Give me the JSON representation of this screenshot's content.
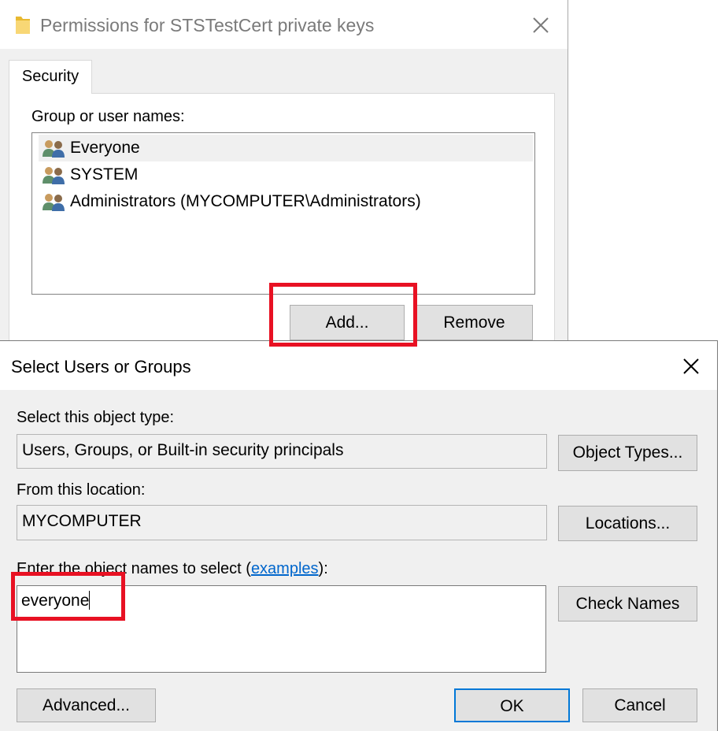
{
  "permissions_window": {
    "title": "Permissions for STSTestCert private keys",
    "tab_label": "Security",
    "group_label": "Group or user names:",
    "principals": [
      {
        "name": "Everyone",
        "icon": "users-group-icon",
        "selected": true
      },
      {
        "name": "SYSTEM",
        "icon": "users-group-icon",
        "selected": false
      },
      {
        "name": "Administrators (MYCOMPUTER\\Administrators)",
        "icon": "users-group-icon",
        "selected": false
      }
    ],
    "add_button": "Add...",
    "remove_button": "Remove"
  },
  "select_dialog": {
    "title": "Select Users or Groups",
    "object_type_label": "Select this object type:",
    "object_type_value": "Users, Groups, or Built-in security principals",
    "object_types_button": "Object Types...",
    "location_label": "From this location:",
    "location_value": "MYCOMPUTER",
    "locations_button": "Locations...",
    "names_label_prefix": "Enter the object names to select (",
    "names_label_link": "examples",
    "names_label_suffix": "):",
    "names_value": "everyone",
    "check_names_button": "Check Names",
    "advanced_button": "Advanced...",
    "ok_button": "OK",
    "cancel_button": "Cancel"
  },
  "colors": {
    "highlight": "#e81123",
    "link": "#0066cc",
    "default_button_border": "#0078d7"
  }
}
